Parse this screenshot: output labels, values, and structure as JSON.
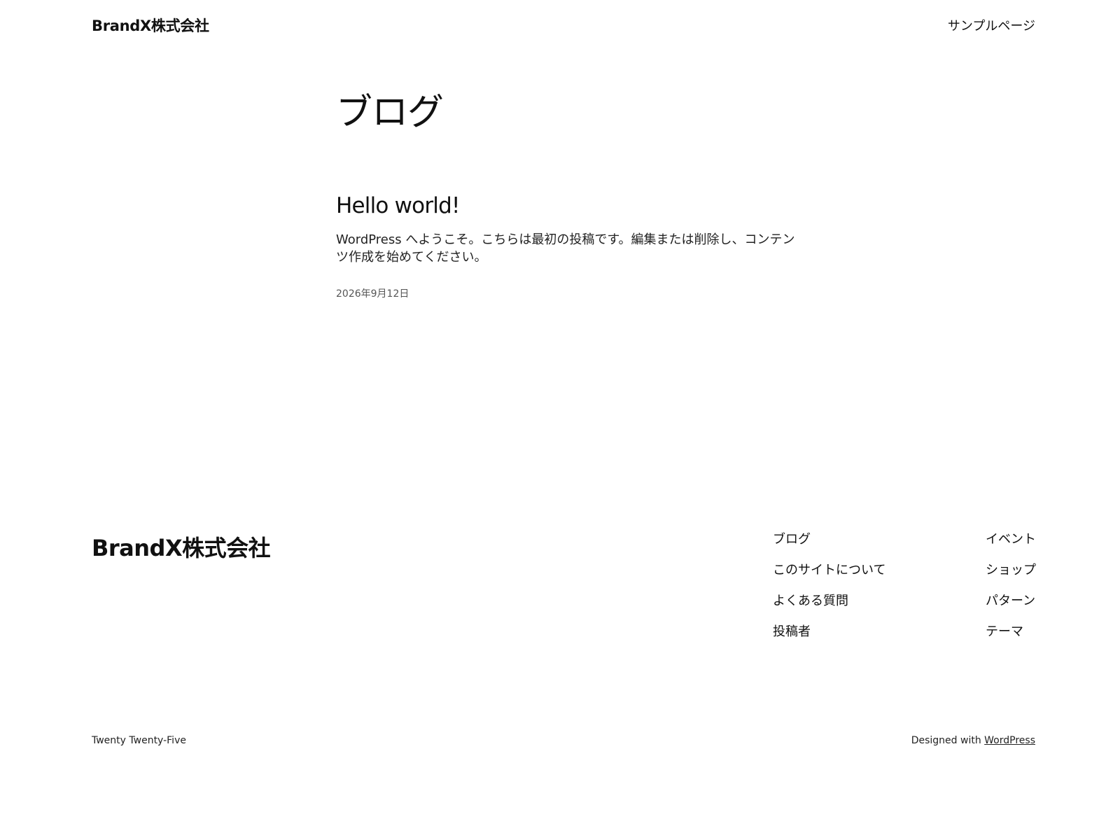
{
  "header": {
    "site_title": "BrandX株式会社",
    "nav": [
      "サンプルページ"
    ]
  },
  "main": {
    "heading": "ブログ",
    "post": {
      "title": "Hello world!",
      "excerpt": "WordPress へようこそ。こちらは最初の投稿です。編集または削除し、コンテンツ作成を始めてください。",
      "date": "2026年9月12日"
    }
  },
  "footer": {
    "site_title": "BrandX株式会社",
    "nav_col1": [
      "ブログ",
      "このサイトについて",
      "よくある質問",
      "投稿者"
    ],
    "nav_col2": [
      "イベント",
      "ショップ",
      "パターン",
      "テーマ"
    ],
    "theme_name": "Twenty Twenty-Five",
    "credit_prefix": "Designed with ",
    "credit_link": "WordPress"
  }
}
